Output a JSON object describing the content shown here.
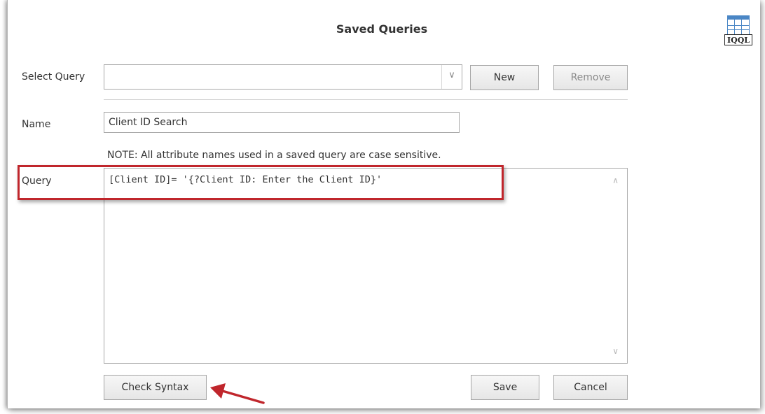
{
  "dialog": {
    "title": "Saved Queries",
    "logo_text": "IQQL"
  },
  "select_query": {
    "label": "Select Query",
    "value": "",
    "new_label": "New",
    "remove_label": "Remove"
  },
  "name_field": {
    "label": "Name",
    "value": "Client ID Search"
  },
  "note": "NOTE:  All attribute names used in a saved query are case sensitive.",
  "query_field": {
    "label": "Query",
    "value": "[Client ID]= '{?Client ID: Enter the Client ID}'"
  },
  "actions": {
    "check_syntax_label": "Check Syntax",
    "save_label": "Save",
    "cancel_label": "Cancel"
  },
  "annotations": {
    "highlight_color": "#c0262c",
    "arrow_color": "#c0262c"
  }
}
